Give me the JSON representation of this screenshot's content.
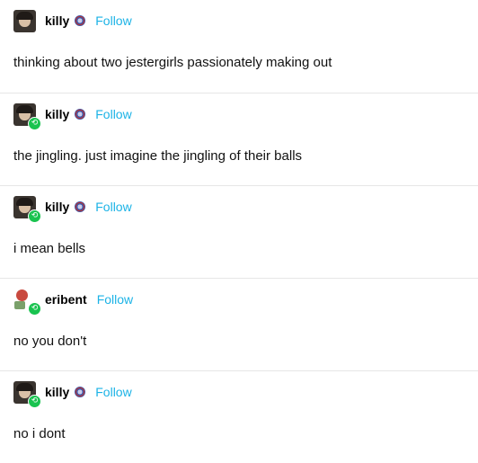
{
  "colors": {
    "follow": "#1cb3e6",
    "reblog_badge": "#19c34f",
    "divider": "#e6e6e6"
  },
  "posts": [
    {
      "username": "killy",
      "avatar_icon": "killy-avatar-icon",
      "has_badge": true,
      "reblogged": false,
      "follow_label": "Follow",
      "text": "thinking about two jestergirls passionately making out"
    },
    {
      "username": "killy",
      "avatar_icon": "killy-avatar-icon",
      "has_badge": true,
      "reblogged": true,
      "follow_label": "Follow",
      "text": "the jingling. just imagine the jingling of their balls"
    },
    {
      "username": "killy",
      "avatar_icon": "killy-avatar-icon",
      "has_badge": true,
      "reblogged": true,
      "follow_label": "Follow",
      "text": "i mean bells"
    },
    {
      "username": "eribent",
      "avatar_icon": "eribent-avatar-icon",
      "has_badge": false,
      "reblogged": true,
      "follow_label": "Follow",
      "text": "no you don't"
    },
    {
      "username": "killy",
      "avatar_icon": "killy-avatar-icon",
      "has_badge": true,
      "reblogged": true,
      "follow_label": "Follow",
      "text": "no i dont"
    }
  ]
}
